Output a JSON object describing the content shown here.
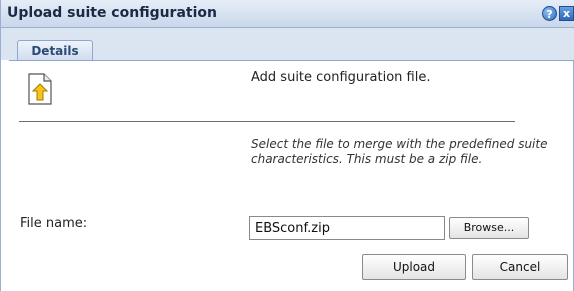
{
  "dialog": {
    "title": "Upload suite configuration",
    "help_icon": "help-icon",
    "help_glyph": "?",
    "close_icon": "close-icon",
    "close_glyph": "x"
  },
  "tabs": [
    {
      "label": "Details",
      "active": true
    }
  ],
  "content": {
    "icon": "upload-file-icon",
    "heading": "Add suite configuration file.",
    "instructions": "Select the file to merge with the predefined suite characteristics. This must be a zip file.",
    "file_label": "File name:",
    "file_value": "EBSconf.zip",
    "browse_label": "Browse..."
  },
  "footer": {
    "upload_label": "Upload",
    "cancel_label": "Cancel"
  },
  "colors": {
    "titlebar": "#c9d7ea",
    "tab_border": "#8ea7cc",
    "title_text": "#1a2a45"
  }
}
